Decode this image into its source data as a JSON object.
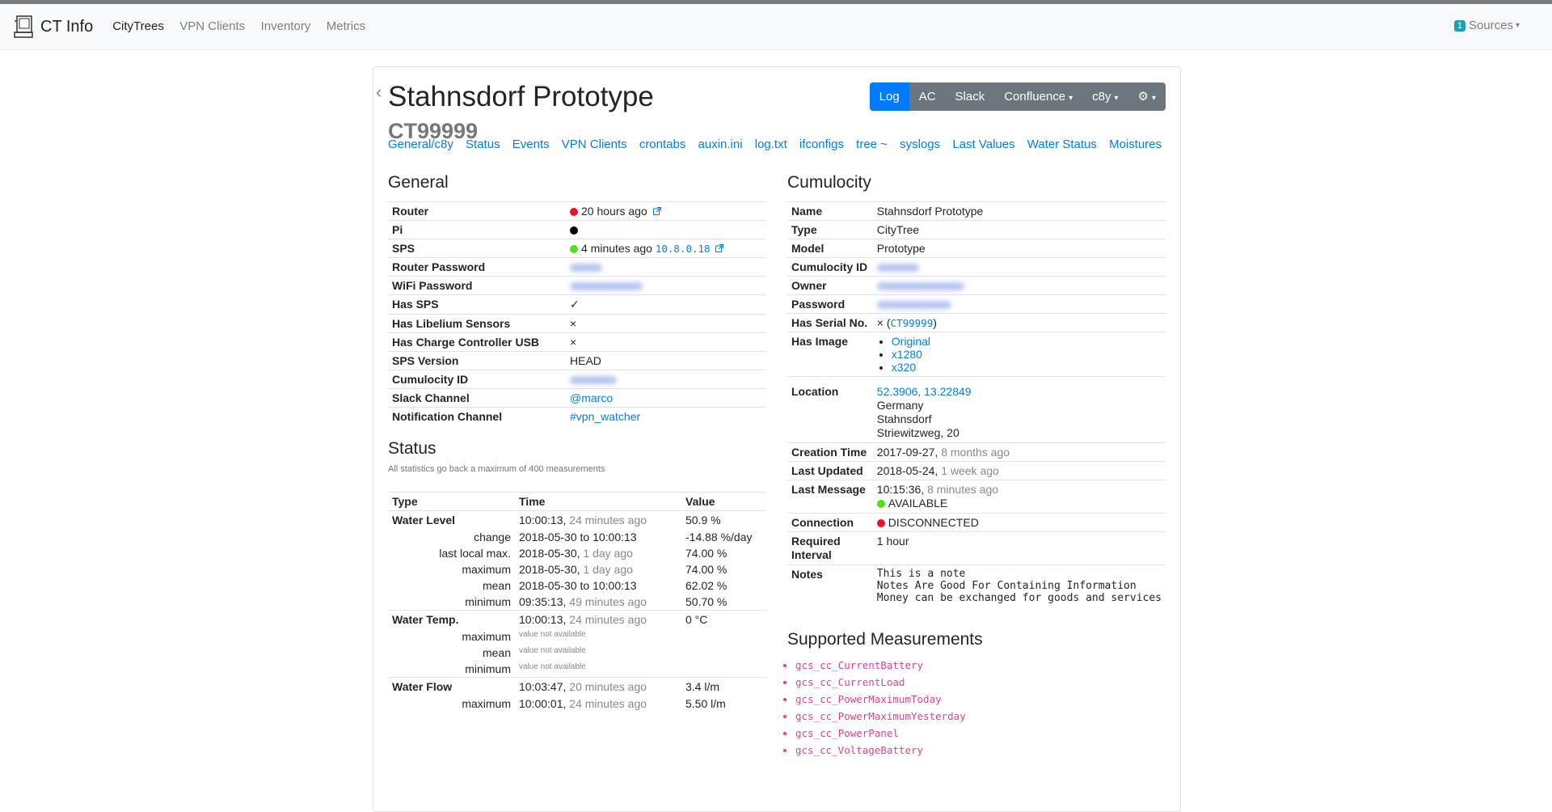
{
  "navbar": {
    "brand": "CT Info",
    "links": [
      "CityTrees",
      "VPN Clients",
      "Inventory",
      "Metrics"
    ],
    "sources_badge": "1",
    "sources_label": "Sources"
  },
  "header": {
    "title": "Stahnsdorf Prototype",
    "subtitle": "CT99999",
    "buttons": [
      "Log",
      "AC",
      "Slack",
      "Confluence",
      "c8y"
    ]
  },
  "subnav": [
    "General/c8y",
    "Status",
    "Events",
    "VPN Clients",
    "crontabs",
    "auxin.ini",
    "log.txt",
    "ifconfigs",
    "tree ~",
    "syslogs",
    "Last Values",
    "Water Status",
    "Moistures"
  ],
  "general": {
    "heading": "General",
    "router_label": "Router",
    "router_value": "20 hours ago",
    "pi_label": "Pi",
    "sps_label": "SPS",
    "sps_value": "4 minutes ago",
    "sps_ip": "10.8.0.18",
    "router_password_label": "Router Password",
    "wifi_password_label": "WiFi Password",
    "has_sps_label": "Has SPS",
    "has_sps_value": "✓",
    "has_libelium_label": "Has Libelium Sensors",
    "has_libelium_value": "×",
    "has_charge_label": "Has Charge Controller USB",
    "has_charge_value": "×",
    "sps_version_label": "SPS Version",
    "sps_version_value": "HEAD",
    "cumulocity_id_label": "Cumulocity ID",
    "slack_label": "Slack Channel",
    "slack_value": "@marco",
    "notification_label": "Notification Channel",
    "notification_value": "#vpn_watcher"
  },
  "status": {
    "heading": "Status",
    "note": "All statistics go back a maximum of 400 measurements",
    "col_type": "Type",
    "col_time": "Time",
    "col_value": "Value",
    "na": "value not available",
    "water_level": {
      "label": "Water Level",
      "time": "10:00:13,",
      "ago": "24 minutes ago",
      "value": "50.9 %",
      "change_label": "change",
      "change_time": "2018-05-30 to 10:00:13",
      "change_value": "-14.88 %/day",
      "llm_label": "last local max.",
      "llm_time": "2018-05-30,",
      "llm_ago": "1 day ago",
      "llm_value": "74.00 %",
      "max_label": "maximum",
      "max_time": "2018-05-30,",
      "max_ago": "1 day ago",
      "max_value": "74.00 %",
      "mean_label": "mean",
      "mean_time": "2018-05-30 to 10:00:13",
      "mean_value": "62.02 %",
      "min_label": "minimum",
      "min_time": "09:35:13,",
      "min_ago": "49 minutes ago",
      "min_value": "50.70 %"
    },
    "water_temp": {
      "label": "Water Temp.",
      "time": "10:00:13,",
      "ago": "24 minutes ago",
      "value": "0 °C",
      "max_label": "maximum",
      "mean_label": "mean",
      "min_label": "minimum"
    },
    "water_flow": {
      "label": "Water Flow",
      "time": "10:03:47,",
      "ago": "20 minutes ago",
      "value": "3.4 l/m",
      "max_label": "maximum",
      "max_time": "10:00:01,",
      "max_ago": "24 minutes ago",
      "max_value": "5.50 l/m"
    }
  },
  "cumulocity": {
    "heading": "Cumulocity",
    "name_label": "Name",
    "name_value": "Stahnsdorf Prototype",
    "type_label": "Type",
    "type_value": "CityTree",
    "model_label": "Model",
    "model_value": "Prototype",
    "cid_label": "Cumulocity ID",
    "owner_label": "Owner",
    "password_label": "Password",
    "serial_label": "Has Serial No.",
    "serial_x": "×",
    "serial_open": " (",
    "serial_value": "CT99999",
    "serial_close": ")",
    "image_label": "Has Image",
    "images": [
      "Original",
      "x1280",
      "x320"
    ],
    "location_label": "Location",
    "location_coords": "52.3906, 13.22849",
    "location_country": "Germany",
    "location_city": "Stahnsdorf",
    "location_street": "Striewitzweg, 20",
    "creation_label": "Creation Time",
    "creation_date": "2017-09-27,",
    "creation_ago": "8 months ago",
    "updated_label": "Last Updated",
    "updated_date": "2018-05-24,",
    "updated_ago": "1 week ago",
    "message_label": "Last Message",
    "message_time": "10:15:36,",
    "message_ago": "8 minutes ago",
    "message_status": "AVAILABLE",
    "connection_label": "Connection",
    "connection_value": "DISCONNECTED",
    "interval_label": "Required Interval",
    "interval_value": "1 hour",
    "notes_label": "Notes",
    "notes": [
      "This is a note",
      "Notes Are Good For Containing Information",
      "Money can be exchanged for goods and services"
    ]
  },
  "supported": {
    "heading": "Supported Measurements",
    "items": [
      "gcs_cc_CurrentBattery",
      "gcs_cc_CurrentLoad",
      "gcs_cc_PowerMaximumToday",
      "gcs_cc_PowerMaximumYesterday",
      "gcs_cc_PowerPanel",
      "gcs_cc_VoltageBattery"
    ]
  },
  "colors": {
    "red": "#e8132b",
    "green": "#51e01b",
    "black": "#000000",
    "link": "#007bff",
    "code": "#e83e8c"
  }
}
